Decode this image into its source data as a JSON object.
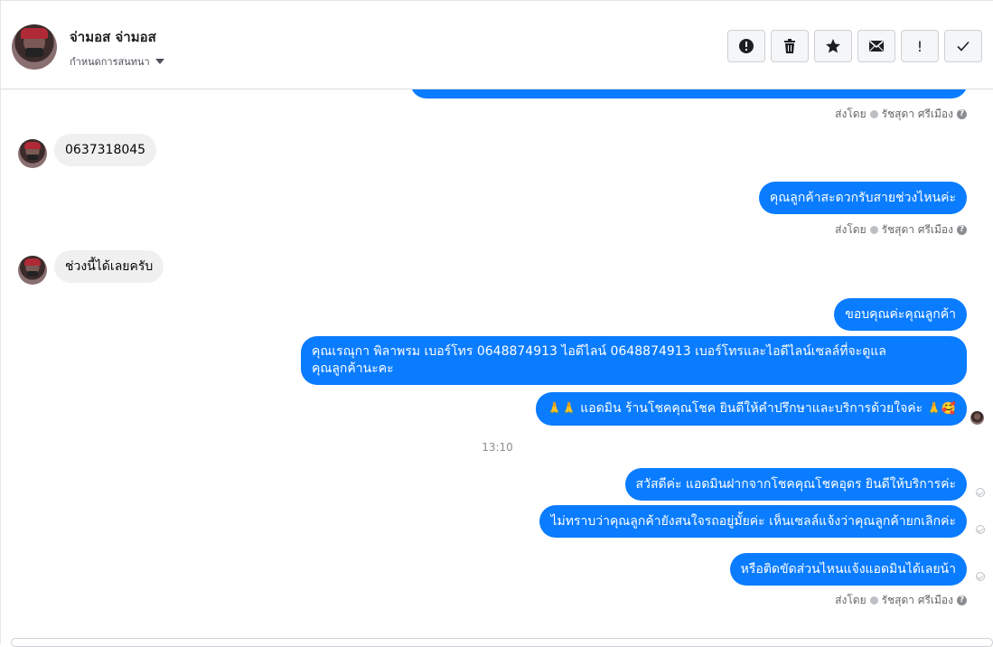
{
  "header": {
    "contact_name": "จ่ามอส จ่ามอส",
    "assign_label": "กำหนดการสนทนา",
    "toolbar_icons": [
      "alert-circle-icon",
      "trash-icon",
      "star-icon",
      "envelope-icon",
      "exclamation-icon",
      "check-icon"
    ],
    "toolbar_labels": {
      "exclaim": "!"
    }
  },
  "messages": {
    "sent_by_prefix": "ส่งโดย",
    "sent_by_name": "รัชสุดา ศรีเมือง",
    "help_glyph": "?",
    "in_1": "0637318045",
    "out_1": "คุณลูกค้าสะดวกรับสายช่วงไหนค่ะ",
    "in_2": "ช่วงนี้ได้เลยครับ",
    "out_2": "ขอบคุณค่ะคุณลูกค้า",
    "out_3_line1": "คุณเรณุกา พิลาพรม        เบอร์โทร 0648874913  ไอดีไลน์ 0648874913   เบอร์โทรและไอดีไลน์เซลล์ที่จะดูแล",
    "out_3_line2": "คุณลูกค้านะคะ",
    "out_4_emoji_left": "🙏🙏",
    "out_4": "แอดมิน ร้านโชคคุณโชค ยินดีให้คำปรึกษาและบริการด้วยใจค่ะ",
    "out_4_emoji_right": "🙏🥰",
    "time_sep": "13:10",
    "out_5": "สวัสดีค่ะ แอดมินฝากจากโชคคุณโชคอุดร ยินดีให้บริการค่ะ",
    "out_6": "ไม่ทราบว่าคุณลูกค้ายังสนใจรถอยู่มั้ยค่ะ  เห็นเซลล์แจ้งว่าคุณลูกค้ายกเลิกค่ะ",
    "out_7": "หรือติดขัดส่วนไหนแจ้งแอดมินได้เลยน้า"
  },
  "colors": {
    "outgoing_bubble": "#0a7cff",
    "incoming_bubble": "#f0f0f0"
  }
}
